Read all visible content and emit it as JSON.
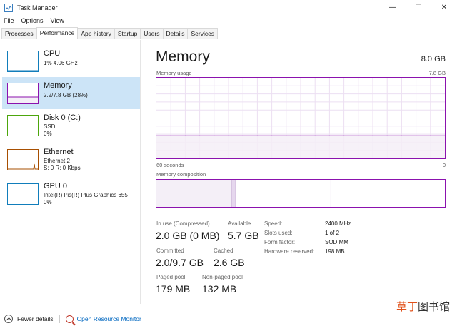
{
  "window": {
    "title": "Task Manager",
    "minimize_glyph": "—",
    "maximize_glyph": "☐",
    "close_glyph": "✕"
  },
  "menu": [
    "File",
    "Options",
    "View"
  ],
  "tabs": [
    "Processes",
    "Performance",
    "App history",
    "Startup",
    "Users",
    "Details",
    "Services"
  ],
  "active_tab": "Performance",
  "sidebar": {
    "items": [
      {
        "name": "CPU",
        "sub1": "1% 4.06 GHz",
        "sub2": "",
        "sub3": "",
        "icon": "cpu-graph-icon"
      },
      {
        "name": "Memory",
        "sub1": "2.2/7.8 GB (28%)",
        "sub2": "",
        "sub3": "",
        "icon": "memory-graph-icon"
      },
      {
        "name": "Disk 0 (C:)",
        "sub1": "SSD",
        "sub2": "0%",
        "sub3": "",
        "icon": "disk-graph-icon"
      },
      {
        "name": "Ethernet",
        "sub1": "Ethernet 2",
        "sub2": "S: 0 R: 0 Kbps",
        "sub3": "",
        "icon": "ethernet-graph-icon"
      },
      {
        "name": "GPU 0",
        "sub1": "Intel(R) Iris(R) Plus Graphics 655",
        "sub2": "0%",
        "sub3": "",
        "icon": "gpu-graph-icon"
      }
    ],
    "selected": "Memory"
  },
  "main": {
    "title": "Memory",
    "total": "8.0 GB",
    "usage_label": "Memory usage",
    "usage_max": "7.8 GB",
    "time_left": "60 seconds",
    "time_right": "0",
    "usage_fraction": 0.28,
    "composition_label": "Memory composition",
    "composition": {
      "in_use_fraction": 0.26,
      "modified_fraction": 0.015,
      "standby_fraction": 0.33
    },
    "stats": {
      "in_use_label": "In use (Compressed)",
      "in_use_value": "2.0 GB (0 MB)",
      "available_label": "Available",
      "available_value": "5.7 GB",
      "committed_label": "Committed",
      "committed_value": "2.0/9.7 GB",
      "cached_label": "Cached",
      "cached_value": "2.6 GB",
      "paged_label": "Paged pool",
      "paged_value": "179 MB",
      "nonpaged_label": "Non-paged pool",
      "nonpaged_value": "132 MB"
    },
    "specs": [
      {
        "label": "Speed:",
        "value": "2400 MHz"
      },
      {
        "label": "Slots used:",
        "value": "1 of 2"
      },
      {
        "label": "Form factor:",
        "value": "SODIMM"
      },
      {
        "label": "Hardware reserved:",
        "value": "198 MB"
      }
    ]
  },
  "footer": {
    "fewer_details": "Fewer details",
    "open_monitor": "Open Resource Monitor"
  },
  "watermark": {
    "accent": "草丁",
    "rest": "图书馆"
  },
  "colors": {
    "memory": "#8b12ae",
    "memory_fill": "#f4eff7",
    "cpu": "#117dbb",
    "disk": "#4da60c",
    "ethernet": "#a74f01",
    "selected_bg": "#cce4f7",
    "link": "#0067c0"
  }
}
